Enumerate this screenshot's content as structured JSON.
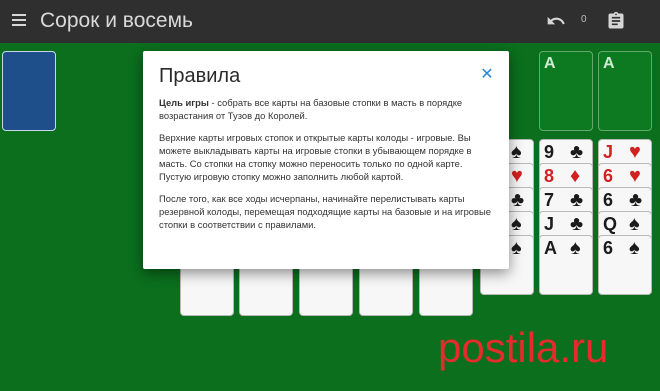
{
  "header": {
    "title": "Сорок и восемь",
    "move_count": "0",
    "menu_icon": "menu-icon",
    "undo_icon": "undo-icon",
    "rules_icon": "clipboard-icon"
  },
  "foundations": [
    "A",
    "A"
  ],
  "tableau_visible": [
    {
      "cards": [
        [
          "9",
          "♣",
          "black"
        ],
        [
          "8",
          "♦",
          "red"
        ],
        [
          "7",
          "♣",
          "black"
        ],
        [
          "J",
          "♣",
          "black"
        ],
        [
          "A",
          "♠",
          "black"
        ]
      ]
    },
    {
      "cards": [
        [
          "J",
          "♥",
          "red"
        ],
        [
          "6",
          "♥",
          "red"
        ],
        [
          "6",
          "♣",
          "black"
        ],
        [
          "Q",
          "♠",
          "black"
        ],
        [
          "6",
          "♠",
          "black"
        ]
      ]
    }
  ],
  "partial_suits": [
    [
      "♠",
      "black"
    ],
    [
      "♥",
      "red"
    ],
    [
      "♣",
      "black"
    ],
    [
      "♠",
      "black"
    ],
    [
      "♠",
      "black"
    ]
  ],
  "dialog": {
    "title": "Правила",
    "goal_label": "Цель игры",
    "goal_text": " - собрать все карты на базовые стопки в масть в порядке возрастания от Тузов до Королей.",
    "p2": "Верхние карты игровых стопок и открытые карты колоды - игровые. Вы можете выкладывать карты на игровые стопки в убывающем порядке в масть. Со стопки на стопку можно переносить только по одной карте. Пустую игровую стопку можно заполнить любой картой.",
    "p3": "После того, как все ходы исчерпаны, начинайте перелистывать карты резервной колоды, перемещая подходящие карты на базовые и на игровые стопки в соответствии с правилами.",
    "close_icon": "close-icon"
  },
  "watermark": "postila.ru",
  "colors": {
    "table": "#0b6f1e",
    "topbar": "#2f2f2f",
    "accent": "#2b88d8"
  }
}
